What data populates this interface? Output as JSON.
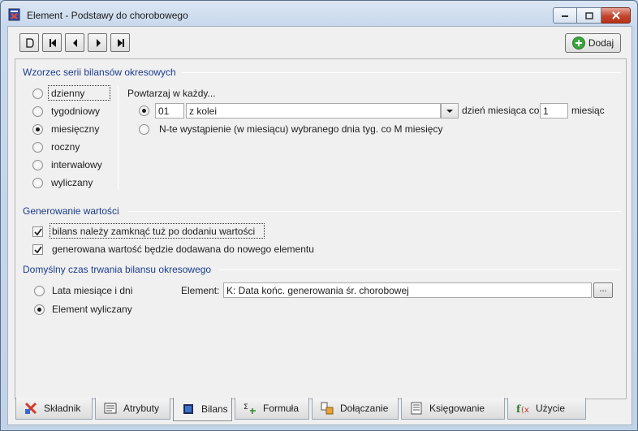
{
  "window": {
    "title": "Element - Podstawy do chorobowego",
    "icons": {
      "app": "app-document-icon",
      "minimize": "minimize-icon",
      "maximize": "maximize-icon",
      "close": "close-icon"
    }
  },
  "toolbar": {
    "nav_icons": [
      "new-record-icon",
      "first-record-icon",
      "prev-record-icon",
      "next-record-icon",
      "last-record-icon"
    ],
    "add_label": "Dodaj",
    "add_icon": "plus-circle-icon"
  },
  "series_pattern": {
    "title": "Wzorzec serii bilansów okresowych",
    "frequency_options": [
      {
        "label": "dzienny",
        "checked": false
      },
      {
        "label": "tygodniowy",
        "checked": false
      },
      {
        "label": "miesięczny",
        "checked": true
      },
      {
        "label": "roczny",
        "checked": false
      },
      {
        "label": "interwałowy",
        "checked": false
      },
      {
        "label": "wyliczany",
        "checked": false
      }
    ],
    "repeat_label": "Powtarzaj w każdy...",
    "day_value": "01",
    "consecutive_value": "z kolei",
    "day_of_month_label": "dzień miesiąca co",
    "month_interval": "1",
    "month_label": "miesiąc",
    "nth_option_label": "N-te wystąpienie (w miesiącu) wybranego dnia tyg. co M miesięcy"
  },
  "value_generation": {
    "title": "Generowanie wartości",
    "options": [
      {
        "label": "bilans należy zamknąć tuż po dodaniu wartości",
        "checked": true
      },
      {
        "label": "generowana wartość będzie dodawana do nowego elementu",
        "checked": true
      }
    ]
  },
  "duration": {
    "title": "Domyślny czas trwania bilansu okresowego",
    "options": [
      {
        "label": "Lata miesiące i dni",
        "checked": false
      },
      {
        "label": "Element wyliczany",
        "checked": true
      }
    ],
    "element_label": "Element:",
    "element_value": "K: Data końc. generowania śr. chorobowej",
    "browse_label": "..."
  },
  "tabs": [
    {
      "label": "Składnik",
      "icon": "component-icon",
      "active": false
    },
    {
      "label": "Atrybuty",
      "icon": "attributes-icon",
      "active": false
    },
    {
      "label": "Bilans",
      "icon": "balance-icon",
      "active": true
    },
    {
      "label": "Formuła",
      "icon": "formula-icon",
      "active": false
    },
    {
      "label": "Dołączanie",
      "icon": "attach-icon",
      "active": false
    },
    {
      "label": "Księgowanie",
      "icon": "accounting-icon",
      "active": false
    },
    {
      "label": "Użycie",
      "icon": "usage-function-icon",
      "active": false
    }
  ],
  "colors": {
    "section_title": "#1a3c8c",
    "window_frame": "#c5d5e8",
    "close_button": "#c3442d"
  }
}
